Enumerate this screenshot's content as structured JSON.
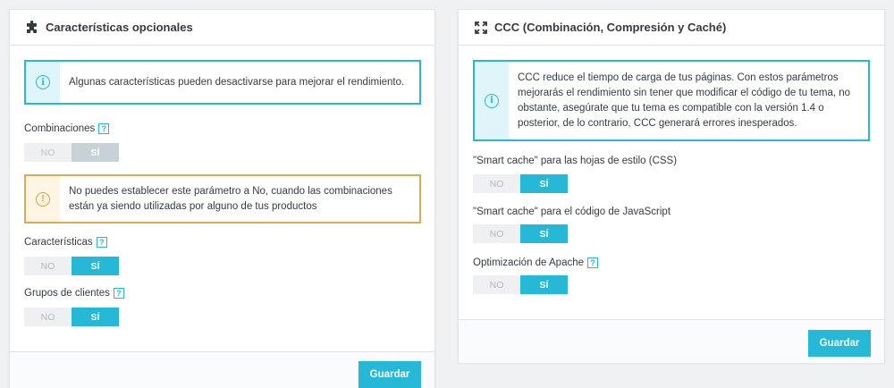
{
  "left_panel": {
    "title": "Características opcionales",
    "title_icon": "puzzle-icon",
    "info_alert": "Algunas características pueden desactivarse para mejorar el rendimiento.",
    "combinations": {
      "label": "Combinaciones",
      "no": "NO",
      "yes": "SÍ",
      "selected": "yes",
      "disabled": true
    },
    "warning_alert": "No puedes establecer este parámetro a No, cuando las combinaciones están ya siendo utilizadas por alguno de tus productos",
    "features": {
      "label": "Características",
      "no": "NO",
      "yes": "SÍ",
      "selected": "yes"
    },
    "customer_groups": {
      "label": "Grupos de clientes",
      "no": "NO",
      "yes": "SÍ",
      "selected": "yes"
    },
    "save_label": "Guardar"
  },
  "right_panel": {
    "title": "CCC (Combinación, Compresión y Caché)",
    "title_icon": "expand-icon",
    "info_alert": "CCC reduce el tiempo de carga de tus páginas. Con estos parámetros mejorarás el rendimiento sin tener que modificar el código de tu tema, no obstante, asegúrate que tu tema es compatible con la versión 1.4 o posterior, de lo contrario, CCC generará errores inesperados.",
    "smart_cache_css": {
      "label": "\"Smart cache\" para las hojas de estilo (CSS)",
      "no": "NO",
      "yes": "SÍ",
      "selected": "yes"
    },
    "smart_cache_js": {
      "label": "\"Smart cache\" para el código de JavaScript",
      "no": "NO",
      "yes": "SÍ",
      "selected": "yes"
    },
    "apache": {
      "label": "Optimización de Apache",
      "no": "NO",
      "yes": "SÍ",
      "selected": "yes"
    },
    "save_label": "Guardar"
  },
  "help_glyph": "?",
  "info_glyph": "i",
  "warning_glyph": "!",
  "colors": {
    "accent": "#25b9d7",
    "warning": "#ddaa4e",
    "background": "#eff1f2"
  }
}
